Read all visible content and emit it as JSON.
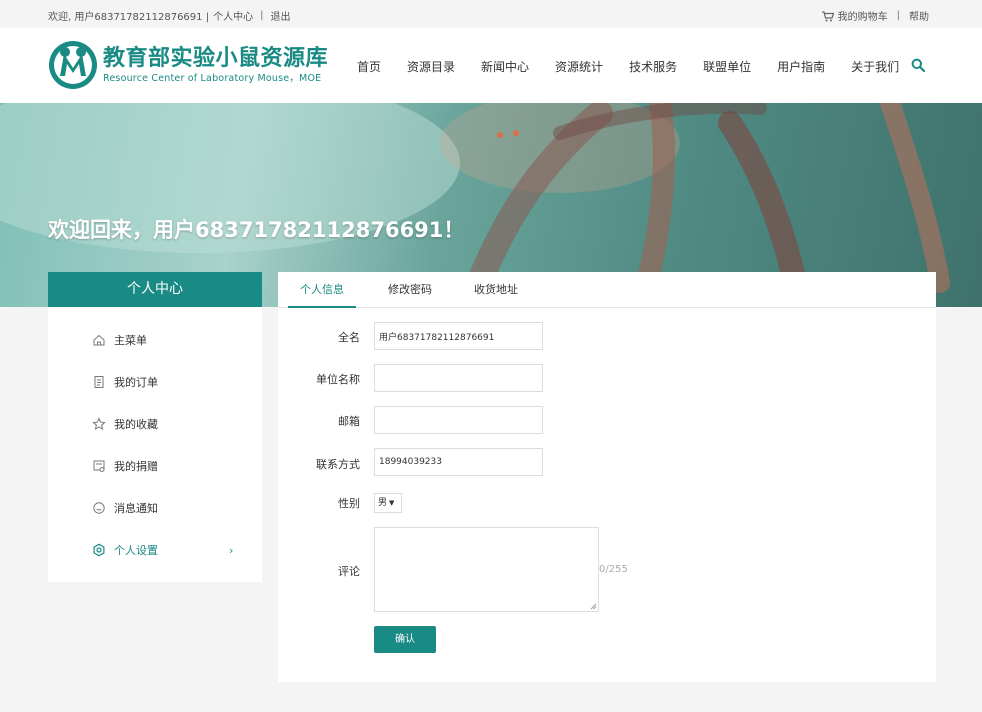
{
  "topbar": {
    "welcome": "欢迎, 用户68371782112876691 |",
    "personal_center": "个人中心",
    "separator": "|",
    "logout": "退出",
    "cart": "我的购物车",
    "help": "帮助"
  },
  "logo": {
    "title_cn": "教育部实验小鼠资源库",
    "title_en": "Resource Center of Laboratory Mouse，MOE"
  },
  "nav": {
    "items": [
      "首页",
      "资源目录",
      "新闻中心",
      "资源统计",
      "技术服务",
      "联盟单位",
      "用户指南",
      "关于我们"
    ]
  },
  "banner": {
    "welcome_text": "欢迎回来，用户68371782112876691！"
  },
  "sidebar": {
    "title": "个人中心",
    "items": [
      {
        "label": "主菜单",
        "icon": "home-icon"
      },
      {
        "label": "我的订单",
        "icon": "order-icon"
      },
      {
        "label": "我的收藏",
        "icon": "star-icon"
      },
      {
        "label": "我的捐赠",
        "icon": "donation-icon"
      },
      {
        "label": "消息通知",
        "icon": "message-icon"
      },
      {
        "label": "个人设置",
        "icon": "settings-icon",
        "active": true
      }
    ],
    "chevron": "›"
  },
  "tabs": [
    "个人信息",
    "修改密码",
    "收货地址"
  ],
  "form": {
    "fullname_label": "全名",
    "fullname_value": "用户68371782112876691",
    "org_label": "单位名称",
    "org_value": "",
    "email_label": "邮箱",
    "email_value": "",
    "phone_label": "联系方式",
    "phone_value": "18994039233",
    "gender_label": "性别",
    "gender_value": "男",
    "comment_label": "评论",
    "comment_counter": "0/255",
    "submit_label": "确认"
  },
  "colors": {
    "accent": "#1a8a84",
    "background": "#f4f4f4"
  }
}
